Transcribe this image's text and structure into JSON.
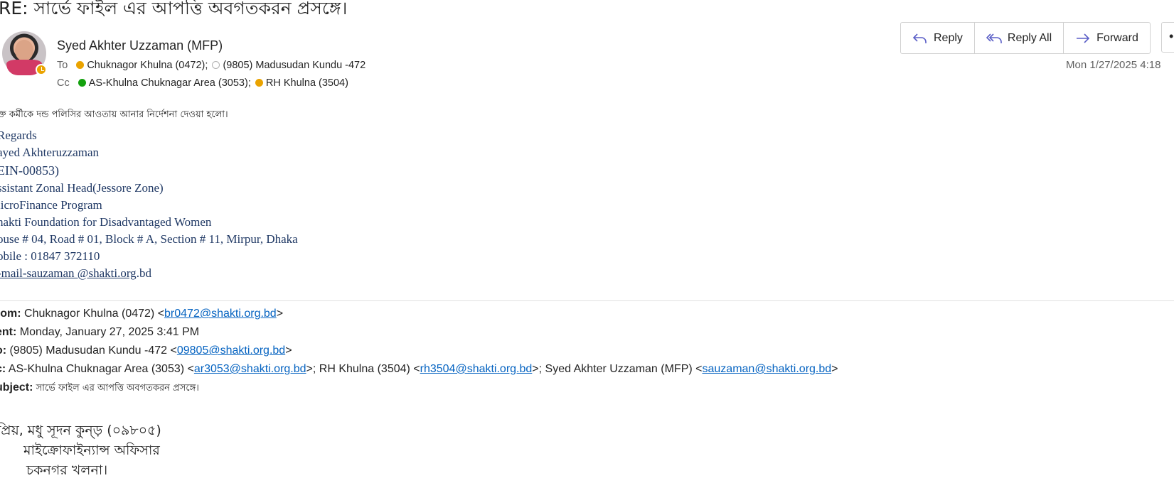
{
  "email": {
    "subject": "RE: সার্ভে ফাইল এর আপত্তি অবগতকরন প্রসঙ্গে।",
    "sender": "Syed Akhter Uzzaman (MFP)",
    "to_label": "To",
    "cc_label": "Cc",
    "to": [
      {
        "name": "Chuknagor Khulna (0472);",
        "status": "away",
        "color": "#eaa300"
      },
      {
        "name": "(9805) Madusudan Kundu  -472",
        "status": "offline",
        "color": "#ffffff"
      }
    ],
    "cc": [
      {
        "name": "AS-Khulna Chuknagar Area (3053);",
        "status": "available",
        "color": "#13a10e"
      },
      {
        "name": "RH Khulna (3504)",
        "status": "away",
        "color": "#eaa300"
      }
    ],
    "date": "Mon 1/27/2025 4:18"
  },
  "actions": {
    "reply": "Reply",
    "reply_all": "Reply All",
    "forward": "Forward",
    "more": "•"
  },
  "body": {
    "line1": "ক্ত কর্মীকে দন্ড পলিসির আওতায় আনার নির্দেশনা দেওয়া হলো।"
  },
  "signature": {
    "lines": [
      "Regards",
      "ayed Akhteruzzaman",
      "EIN-00853)",
      "ssistant Zonal Head(Jessore Zone)",
      "licroFinance Program",
      "hakti Foundation for Disadvantaged Women",
      "ouse # 04, Road # 01, Block # A, Section # 11, Mirpur, Dhaka",
      "obile : 01847 372110"
    ],
    "email_link": "-mail-sauzaman @shakti.org",
    "email_tail": ".bd"
  },
  "original": {
    "from_label": "rom:",
    "from_name": " Chuknagor Khulna (0472) <",
    "from_email": "br0472@shakti.org.bd",
    "sent_label": "ent:",
    "sent_value": " Monday, January 27, 2025 3:41 PM",
    "to_label": "o:",
    "to_name": " (9805) Madusudan Kundu -472 <",
    "to_email": "09805@shakti.org.bd",
    "cc_label": "c:",
    "cc_name1": " AS-Khulna Chuknagar Area (3053) <",
    "cc_email1": "ar3053@shakti.org.bd",
    "cc_name2": ">; RH Khulna (3504) <",
    "cc_email2": "rh3504@shakti.org.bd",
    "cc_name3": ">; Syed Akhter Uzzaman (MFP) <",
    "cc_email3": "sauzaman@shakti.org.bd",
    "close": ">",
    "subject_label": "ubject:",
    "subject_value": " সার্ভে ফাইল এর আপত্তি অবগতকরন প্রসঙ্গে।"
  },
  "greeting": {
    "line1": "প্রিয়, মধু সূদন কুন্ড় (০৯৮০৫)",
    "line2": "মাইক্রোফাইন্যান্স অফিসার",
    "line3": "চকনগর খলনা।"
  }
}
